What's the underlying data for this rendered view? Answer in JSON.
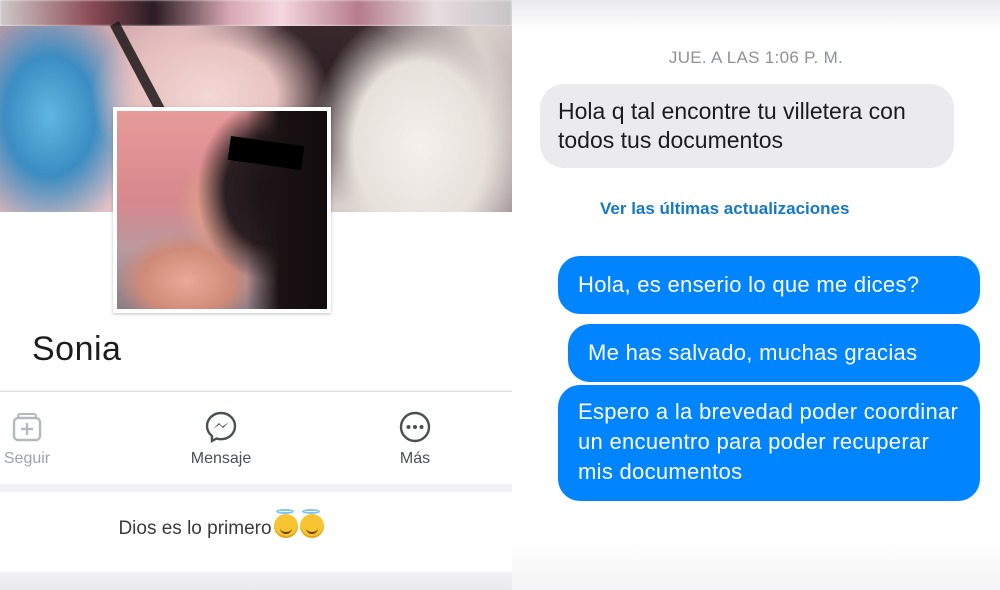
{
  "profile": {
    "name": "Sonia",
    "bio": "Dios es lo primero"
  },
  "actions": {
    "follow_label": "Seguir",
    "message_label": "Mensaje",
    "more_label": "Más"
  },
  "chat": {
    "timestamp": "JUE. A LAS 1:06 P. M.",
    "incoming": [
      "Hola q tal encontre tu villetera con todos tus  documentos"
    ],
    "updates_link": "Ver las últimas actualizaciones",
    "outgoing": [
      "Hola, es enserio lo que me dices?",
      "Me has salvado, muchas gracias",
      "Espero a la brevedad poder coordinar un encuentro para poder recuperar mis documentos"
    ]
  },
  "colors": {
    "outgoing_bubble": "#0084ff",
    "incoming_bubble": "#ebebee",
    "link": "#1578c8"
  },
  "icons": [
    "follow-icon",
    "messenger-icon",
    "more-icon",
    "halo-emoji"
  ]
}
